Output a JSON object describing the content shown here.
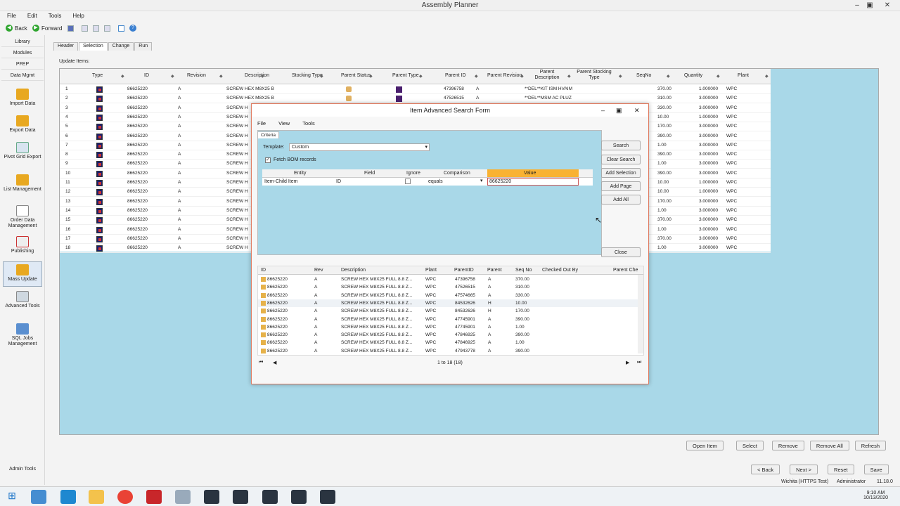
{
  "app": {
    "title": "Assembly Planner"
  },
  "menu": {
    "file": "File",
    "edit": "Edit",
    "tools": "Tools",
    "help": "Help"
  },
  "toolbar": {
    "back": "Back",
    "forward": "Forward"
  },
  "sidebar": {
    "tabs": [
      "Library",
      "Modules",
      "PFEP",
      "Data Mgmt"
    ],
    "items": [
      {
        "label": "Import Data"
      },
      {
        "label": "Export Data"
      },
      {
        "label": "Pivot Grid Export"
      },
      {
        "label": "List Management"
      },
      {
        "label": "Order Data Management"
      },
      {
        "label": "Publishing"
      },
      {
        "label": "Mass Update"
      },
      {
        "label": "Advanced Tools"
      },
      {
        "label": "SQL Jobs Management"
      }
    ],
    "admin": "Admin Tools"
  },
  "content": {
    "tabs": [
      "Header",
      "Selection",
      "Change",
      "Run"
    ],
    "update_items_label": "Update Items:"
  },
  "grid": {
    "headers": [
      "Type",
      "ID",
      "Revision",
      "Description",
      "Stocking Type",
      "Parent Status",
      "Parent Type",
      "Parent ID",
      "Parent Revision",
      "Parent Description",
      "Parent Stocking Type",
      "SeqNo",
      "Quantity",
      "Plant"
    ],
    "rows": [
      {
        "n": "1",
        "id": "86625220",
        "rev": "A",
        "desc": "SCREW HEX M8X25 B",
        "pid": "47396758",
        "prev": "A",
        "pdesc": "**DEL**KIT ISM HVAIM",
        "seq": "370.00",
        "qty": "1.000000",
        "plant": "WPC"
      },
      {
        "n": "2",
        "id": "86625220",
        "rev": "A",
        "desc": "SCREW HEX M8X25 B",
        "pid": "47526515",
        "prev": "A",
        "pdesc": "**DEL**MSM AC PLUZ",
        "seq": "310.00",
        "qty": "3.000000",
        "plant": "WPC"
      },
      {
        "n": "3",
        "id": "86625220",
        "rev": "A",
        "desc": "SCREW H",
        "pid": "",
        "prev": "",
        "pdesc": "",
        "seq": "330.00",
        "qty": "3.000000",
        "plant": "WPC"
      },
      {
        "n": "4",
        "id": "86625220",
        "rev": "A",
        "desc": "SCREW H",
        "pid": "",
        "prev": "",
        "pdesc": "",
        "seq": "10.00",
        "qty": "1.000000",
        "plant": "WPC"
      },
      {
        "n": "5",
        "id": "86625220",
        "rev": "A",
        "desc": "SCREW H",
        "pid": "",
        "prev": "",
        "pdesc": "",
        "seq": "170.00",
        "qty": "3.000000",
        "plant": "WPC"
      },
      {
        "n": "6",
        "id": "86625220",
        "rev": "A",
        "desc": "SCREW H",
        "pid": "",
        "prev": "",
        "pdesc": "",
        "seq": "390.00",
        "qty": "3.000000",
        "plant": "WPC"
      },
      {
        "n": "7",
        "id": "86625220",
        "rev": "A",
        "desc": "SCREW H",
        "pid": "",
        "prev": "",
        "pdesc": "",
        "seq": "1.00",
        "qty": "3.000000",
        "plant": "WPC"
      },
      {
        "n": "8",
        "id": "86625220",
        "rev": "A",
        "desc": "SCREW H",
        "pid": "",
        "prev": "",
        "pdesc": "",
        "seq": "390.00",
        "qty": "3.000000",
        "plant": "WPC"
      },
      {
        "n": "9",
        "id": "86625220",
        "rev": "A",
        "desc": "SCREW H",
        "pid": "",
        "prev": "",
        "pdesc": "",
        "seq": "1.00",
        "qty": "3.000000",
        "plant": "WPC"
      },
      {
        "n": "10",
        "id": "86625220",
        "rev": "A",
        "desc": "SCREW H",
        "pid": "",
        "prev": "",
        "pdesc": "",
        "seq": "390.00",
        "qty": "3.000000",
        "plant": "WPC"
      },
      {
        "n": "11",
        "id": "86625220",
        "rev": "A",
        "desc": "SCREW H",
        "pid": "",
        "prev": "",
        "pdesc": "",
        "seq": "10.00",
        "qty": "1.000000",
        "plant": "WPC"
      },
      {
        "n": "12",
        "id": "86625220",
        "rev": "A",
        "desc": "SCREW H",
        "pid": "",
        "prev": "",
        "pdesc": "",
        "seq": "10.00",
        "qty": "1.000000",
        "plant": "WPC"
      },
      {
        "n": "13",
        "id": "86625220",
        "rev": "A",
        "desc": "SCREW H",
        "pid": "",
        "prev": "",
        "pdesc": "",
        "seq": "170.00",
        "qty": "3.000000",
        "plant": "WPC"
      },
      {
        "n": "14",
        "id": "86625220",
        "rev": "A",
        "desc": "SCREW H",
        "pid": "",
        "prev": "",
        "pdesc": "",
        "seq": "1.00",
        "qty": "3.000000",
        "plant": "WPC"
      },
      {
        "n": "15",
        "id": "86625220",
        "rev": "A",
        "desc": "SCREW H",
        "pid": "",
        "prev": "",
        "pdesc": "",
        "seq": "370.00",
        "qty": "3.000000",
        "plant": "WPC"
      },
      {
        "n": "16",
        "id": "86625220",
        "rev": "A",
        "desc": "SCREW H",
        "pid": "",
        "prev": "",
        "pdesc": "",
        "seq": "1.00",
        "qty": "3.000000",
        "plant": "WPC"
      },
      {
        "n": "17",
        "id": "86625220",
        "rev": "A",
        "desc": "SCREW H",
        "pid": "",
        "prev": "",
        "pdesc": "",
        "seq": "370.00",
        "qty": "3.000000",
        "plant": "WPC"
      },
      {
        "n": "18",
        "id": "86625220",
        "rev": "A",
        "desc": "SCREW H",
        "pid": "",
        "prev": "",
        "pdesc": "",
        "seq": "1.00",
        "qty": "3.000000",
        "plant": "WPC"
      }
    ]
  },
  "actions": {
    "open_item": "Open Item",
    "select": "Select",
    "remove": "Remove",
    "remove_all": "Remove All",
    "refresh": "Refresh"
  },
  "nav": {
    "back": "< Back",
    "next": "Next >",
    "reset": "Reset",
    "save": "Save"
  },
  "status": {
    "server": "Wichita (HTTPS Test)",
    "user": "Administrator",
    "version": "11.18.0"
  },
  "clock": {
    "time": "9:10 AM",
    "date": "10/13/2020"
  },
  "dialog": {
    "title": "Item Advanced Search Form",
    "menu": {
      "file": "File",
      "view": "View",
      "tools": "Tools"
    },
    "criteria_tab": "Criteria",
    "template_label": "Template:",
    "template_value": "Custom",
    "fetch_bom_label": "Fetch BOM records",
    "crit_headers": {
      "entity": "Entity",
      "field": "Field",
      "ignore": "Ignore",
      "comparison": "Comparison",
      "value": "Value"
    },
    "crit_row": {
      "entity": "Item-Child Item",
      "field": "ID",
      "comparison": "equals",
      "value": "86625220"
    },
    "buttons": {
      "search": "Search",
      "clear": "Clear Search",
      "add_selection": "Add Selection",
      "add_page": "Add Page",
      "add_all": "Add All",
      "close": "Close"
    },
    "results_headers": {
      "id": "ID",
      "rev": "Rev",
      "desc": "Description",
      "plant": "Plant",
      "parent_id": "ParentID",
      "parent": "Parent",
      "seq": "Seq No",
      "checked": "Checked Out By",
      "parent_ch": "Parent Che"
    },
    "results": [
      {
        "id": "86625220",
        "rev": "A",
        "desc": "SCREW HEX M8X25 FULL 8.8 Z...",
        "plant": "WPC",
        "pid": "47396758",
        "prev": "A",
        "seq": "370.00"
      },
      {
        "id": "86625220",
        "rev": "A",
        "desc": "SCREW HEX M8X25 FULL 8.8 Z...",
        "plant": "WPC",
        "pid": "47526515",
        "prev": "A",
        "seq": "310.00"
      },
      {
        "id": "86625220",
        "rev": "A",
        "desc": "SCREW HEX M8X25 FULL 8.8 Z...",
        "plant": "WPC",
        "pid": "47574665",
        "prev": "A",
        "seq": "330.00"
      },
      {
        "id": "86625220",
        "rev": "A",
        "desc": "SCREW HEX M8X25 FULL 8.8 Z...",
        "plant": "WPC",
        "pid": "84532626",
        "prev": "H",
        "seq": "10.00"
      },
      {
        "id": "86625220",
        "rev": "A",
        "desc": "SCREW HEX M8X25 FULL 8.8 Z...",
        "plant": "WPC",
        "pid": "84532626",
        "prev": "H",
        "seq": "170.00"
      },
      {
        "id": "86625220",
        "rev": "A",
        "desc": "SCREW HEX M8X25 FULL 8.8 Z...",
        "plant": "WPC",
        "pid": "47745901",
        "prev": "A",
        "seq": "390.00"
      },
      {
        "id": "86625220",
        "rev": "A",
        "desc": "SCREW HEX M8X25 FULL 8.8 Z...",
        "plant": "WPC",
        "pid": "47745901",
        "prev": "A",
        "seq": "1.00"
      },
      {
        "id": "86625220",
        "rev": "A",
        "desc": "SCREW HEX M8X25 FULL 8.8 Z...",
        "plant": "WPC",
        "pid": "47846925",
        "prev": "A",
        "seq": "390.00"
      },
      {
        "id": "86625220",
        "rev": "A",
        "desc": "SCREW HEX M8X25 FULL 8.8 Z...",
        "plant": "WPC",
        "pid": "47846925",
        "prev": "A",
        "seq": "1.00"
      },
      {
        "id": "86625220",
        "rev": "A",
        "desc": "SCREW HEX M8X25 FULL 8.8 Z...",
        "plant": "WPC",
        "pid": "47943778",
        "prev": "A",
        "seq": "390.00"
      }
    ],
    "pager": "1 to 18 (18)"
  },
  "colors": {
    "accent": "#2fa52f",
    "panel": "#a9d8e8",
    "value_header": "#f9b233",
    "dialog_border": "#e07a5f"
  },
  "icons": [
    "back-icon",
    "forward-icon",
    "lock-icon",
    "windows-icon",
    "chrome-icon",
    "filezilla-icon"
  ]
}
